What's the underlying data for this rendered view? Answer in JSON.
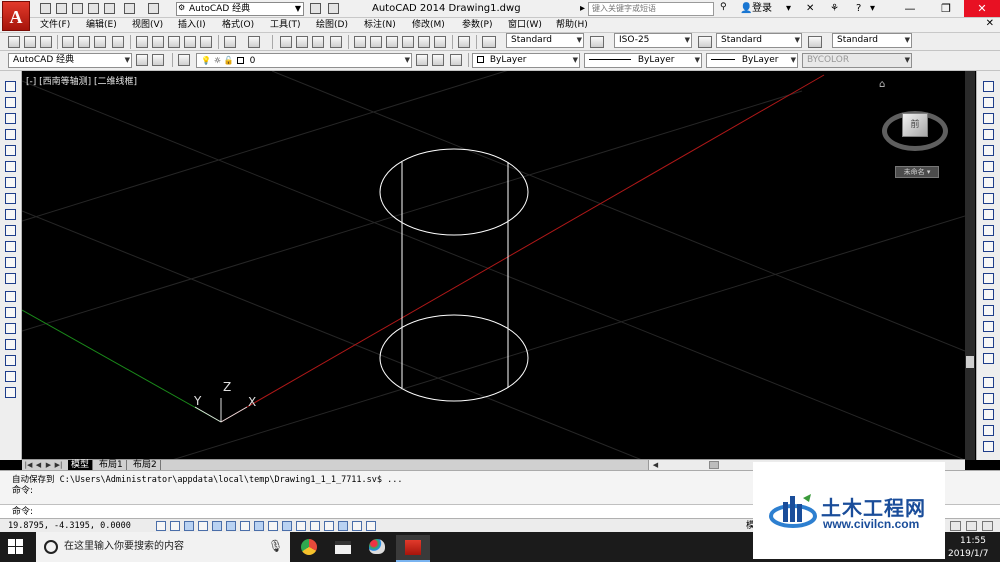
{
  "titlebar": {
    "workspace_selector": "AutoCAD 经典",
    "title": "AutoCAD 2014    Drawing1.dwg",
    "search_placeholder": "键入关键字或短语",
    "login_label": "登录",
    "help_label": "?"
  },
  "menu": {
    "items": [
      "文件(F)",
      "编辑(E)",
      "视图(V)",
      "插入(I)",
      "格式(O)",
      "工具(T)",
      "绘图(D)",
      "标注(N)",
      "修改(M)",
      "参数(P)",
      "窗口(W)",
      "帮助(H)"
    ]
  },
  "styles_toolbar": {
    "text_style": "Standard",
    "dim_style": "ISO-25",
    "table_style": "Standard",
    "multileader_style": "Standard"
  },
  "layers_toolbar": {
    "workspace": "AutoCAD 经典",
    "current_layer": "0",
    "color": "ByLayer",
    "linetype": "ByLayer",
    "lineweight": "ByLayer",
    "plot_style": "BYCOLOR"
  },
  "canvas": {
    "view_label": "[-] [西南等轴测] [二维线框]",
    "viewcube_face": "前",
    "wcs_label": "未命名 ▾",
    "axis_x": "X",
    "axis_y": "Y",
    "axis_z": "Z",
    "colors": {
      "background": "#000000",
      "geometry": "#ffffff",
      "x_axis": "#b01818",
      "y_axis": "#1a8a1a",
      "grid": "#262626"
    }
  },
  "layout_tabs": [
    "模型",
    "布局1",
    "布局2"
  ],
  "command": {
    "history_1": "自动保存到  C:\\Users\\Administrator\\appdata\\local\\temp\\Drawing1_1_1_7711.sv$ ...",
    "history_2": "命令:",
    "prompt": "命令:"
  },
  "status": {
    "coordinates": "19.8795, -4.3195, 0.0000",
    "space": "模"
  },
  "watermark": {
    "title": "土木工程网",
    "url": "www.civilcn.com"
  },
  "taskbar": {
    "search_placeholder": "在这里输入你要搜索的内容",
    "time": "11:55",
    "date": "2019/1/7"
  }
}
